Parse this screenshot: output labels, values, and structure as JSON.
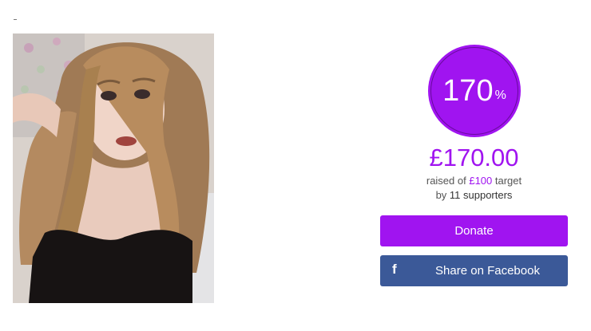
{
  "campaign": {
    "progress_value": "170",
    "progress_unit": "%",
    "progress_fraction": 1.7,
    "amount_raised": "£170.00",
    "raised_prefix": "raised of ",
    "target": "£100",
    "raised_suffix": " target",
    "supporters_prefix": "by ",
    "supporters_count": "11 supporters"
  },
  "actions": {
    "donate_label": "Donate",
    "facebook_icon": "f",
    "facebook_label": "Share on Facebook"
  },
  "colors": {
    "accent": "#a014f0",
    "facebook": "#3b5998"
  },
  "icons": {
    "facebook": "facebook-icon"
  }
}
